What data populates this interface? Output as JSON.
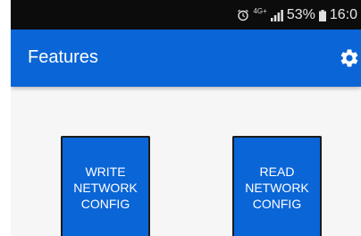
{
  "status_bar": {
    "network": "4G+",
    "battery": "53%",
    "time": "16:0",
    "icons": [
      "alarm-icon",
      "signal-icon",
      "battery-icon"
    ]
  },
  "app_bar": {
    "title": "Features",
    "settings_icon": "gear-icon"
  },
  "buttons": {
    "write_network_config": "WRITE\nNETWORK\nCONFIG",
    "read_network_config": "READ\nNETWORK\nCONFIG"
  },
  "colors": {
    "primary": "#0a65d6",
    "status_bar": "#0c0c0c",
    "background": "#f6f6f6"
  }
}
